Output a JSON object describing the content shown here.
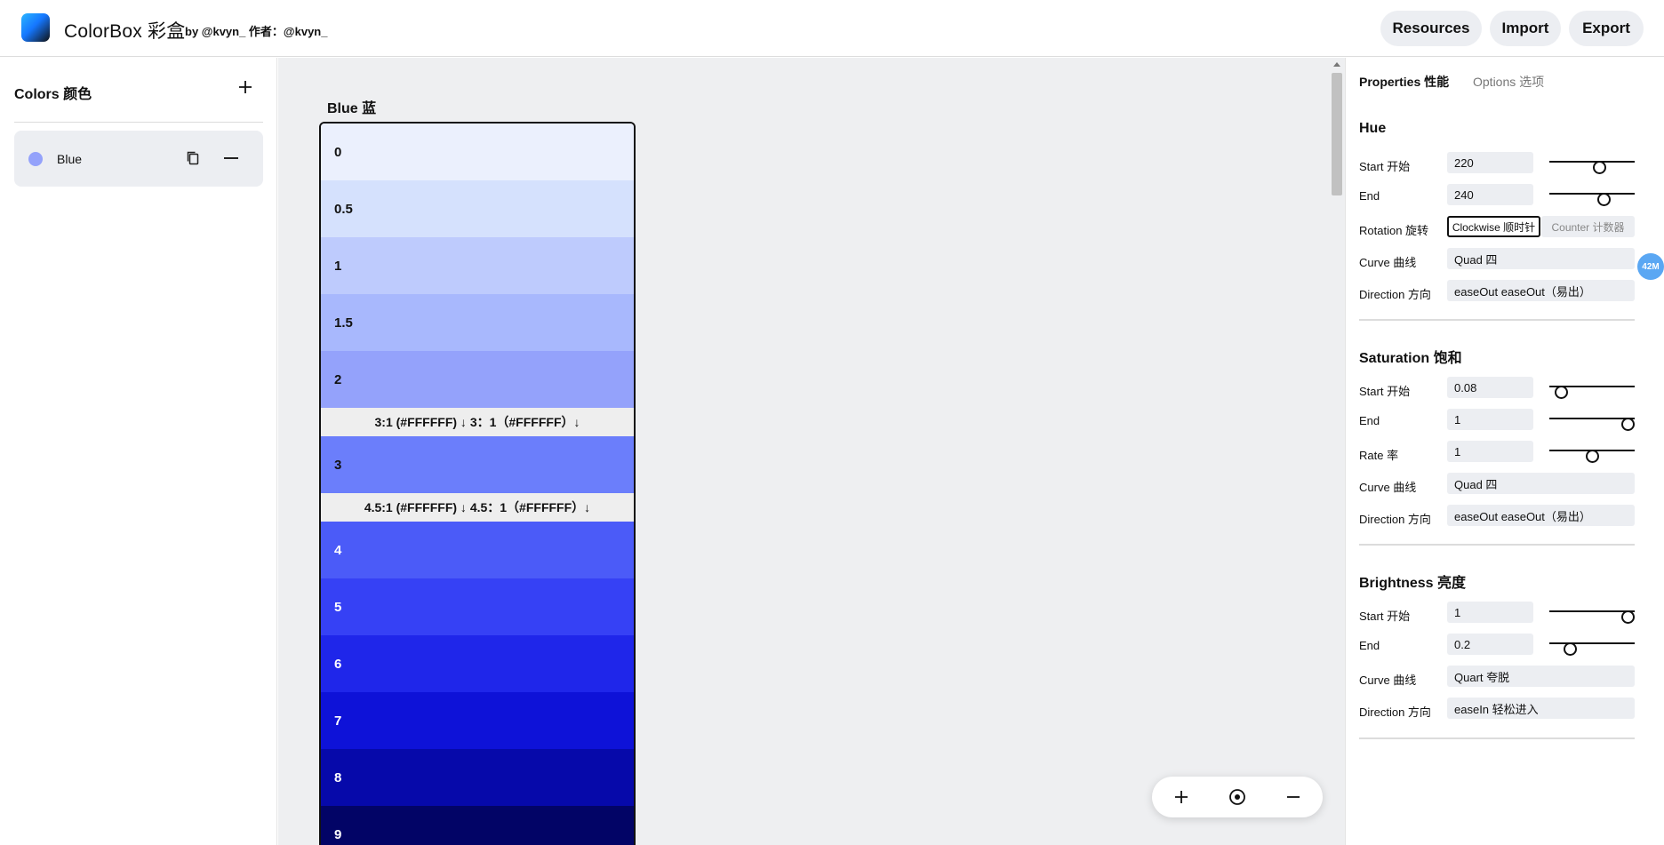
{
  "header": {
    "title": "ColorBox 彩盒",
    "byline": "by @kvyn_ 作者：@kvyn_",
    "buttons": {
      "resources": "Resources",
      "import": "Import",
      "export": "Export"
    }
  },
  "sidebar": {
    "title": "Colors 颜色",
    "items": [
      {
        "name": "Blue",
        "color": "#94a2fb"
      }
    ]
  },
  "palette": {
    "title": "Blue 蓝",
    "rows": [
      {
        "label": "0",
        "color": "#ebf0fd",
        "text": "#111111"
      },
      {
        "label": "0.5",
        "color": "#d5e1fd",
        "text": "#111111"
      },
      {
        "label": "1",
        "color": "#becbfd",
        "text": "#111111"
      },
      {
        "label": "1.5",
        "color": "#a8b8fd",
        "text": "#111111"
      },
      {
        "label": "2",
        "color": "#94a2fb",
        "text": "#111111"
      },
      {
        "label": "3",
        "color": "#6b7efb",
        "text": "#111111"
      },
      {
        "label": "4",
        "color": "#4b5bf8",
        "text": "#ffffff"
      },
      {
        "label": "5",
        "color": "#3641f5",
        "text": "#ffffff"
      },
      {
        "label": "6",
        "color": "#1f26ea",
        "text": "#ffffff"
      },
      {
        "label": "7",
        "color": "#0e12d8",
        "text": "#ffffff"
      },
      {
        "label": "8",
        "color": "#0609aa",
        "text": "#ffffff"
      },
      {
        "label": "9",
        "color": "#020466",
        "text": "#ffffff"
      }
    ],
    "contrast": [
      "3:1 (#FFFFFF) ↓ 3：1（#FFFFFF）↓",
      "4.5:1 (#FFFFFF) ↓ 4.5：1（#FFFFFF）↓"
    ]
  },
  "panel": {
    "tabs": {
      "properties": "Properties 性能",
      "options": "Options 选项"
    },
    "hue": {
      "title": "Hue",
      "start_label": "Start 开始",
      "start_value": "220",
      "end_label": "End",
      "end_value": "240",
      "rotation_label": "Rotation 旋转",
      "rotation_a": "Clockwise 顺时针",
      "rotation_b": "Counter 计数器",
      "curve_label": "Curve 曲线",
      "curve_value": "Quad 四",
      "direction_label": "Direction 方向",
      "direction_value": "easeOut easeOut（易出）",
      "start_level": 0.6,
      "end_level": 0.67
    },
    "saturation": {
      "title": "Saturation 饱和",
      "start_label": "Start 开始",
      "start_value": "0.08",
      "end_label": "End",
      "end_value": "1",
      "rate_label": "Rate 率",
      "rate_value": "1",
      "curve_label": "Curve 曲线",
      "curve_value": "Quad 四",
      "direction_label": "Direction 方向",
      "direction_value": "easeOut easeOut（易出）",
      "start_level": 0.08,
      "end_level": 1,
      "rate_level": 0.5
    },
    "brightness": {
      "title": "Brightness 亮度",
      "start_label": "Start 开始",
      "start_value": "1",
      "end_label": "End",
      "end_value": "0.2",
      "curve_label": "Curve 曲线",
      "curve_value": "Quart 夸脱",
      "direction_label": "Direction 方向",
      "direction_value": "easeIn 轻松进入",
      "start_level": 1,
      "end_level": 0.2
    }
  },
  "badge": "42M",
  "icons": {
    "add": "plus-icon",
    "copy": "copy-icon",
    "remove": "minus-icon",
    "zoom_in": "zoom-in-icon",
    "zoom_reset": "target-icon",
    "zoom_out": "zoom-out-icon"
  }
}
